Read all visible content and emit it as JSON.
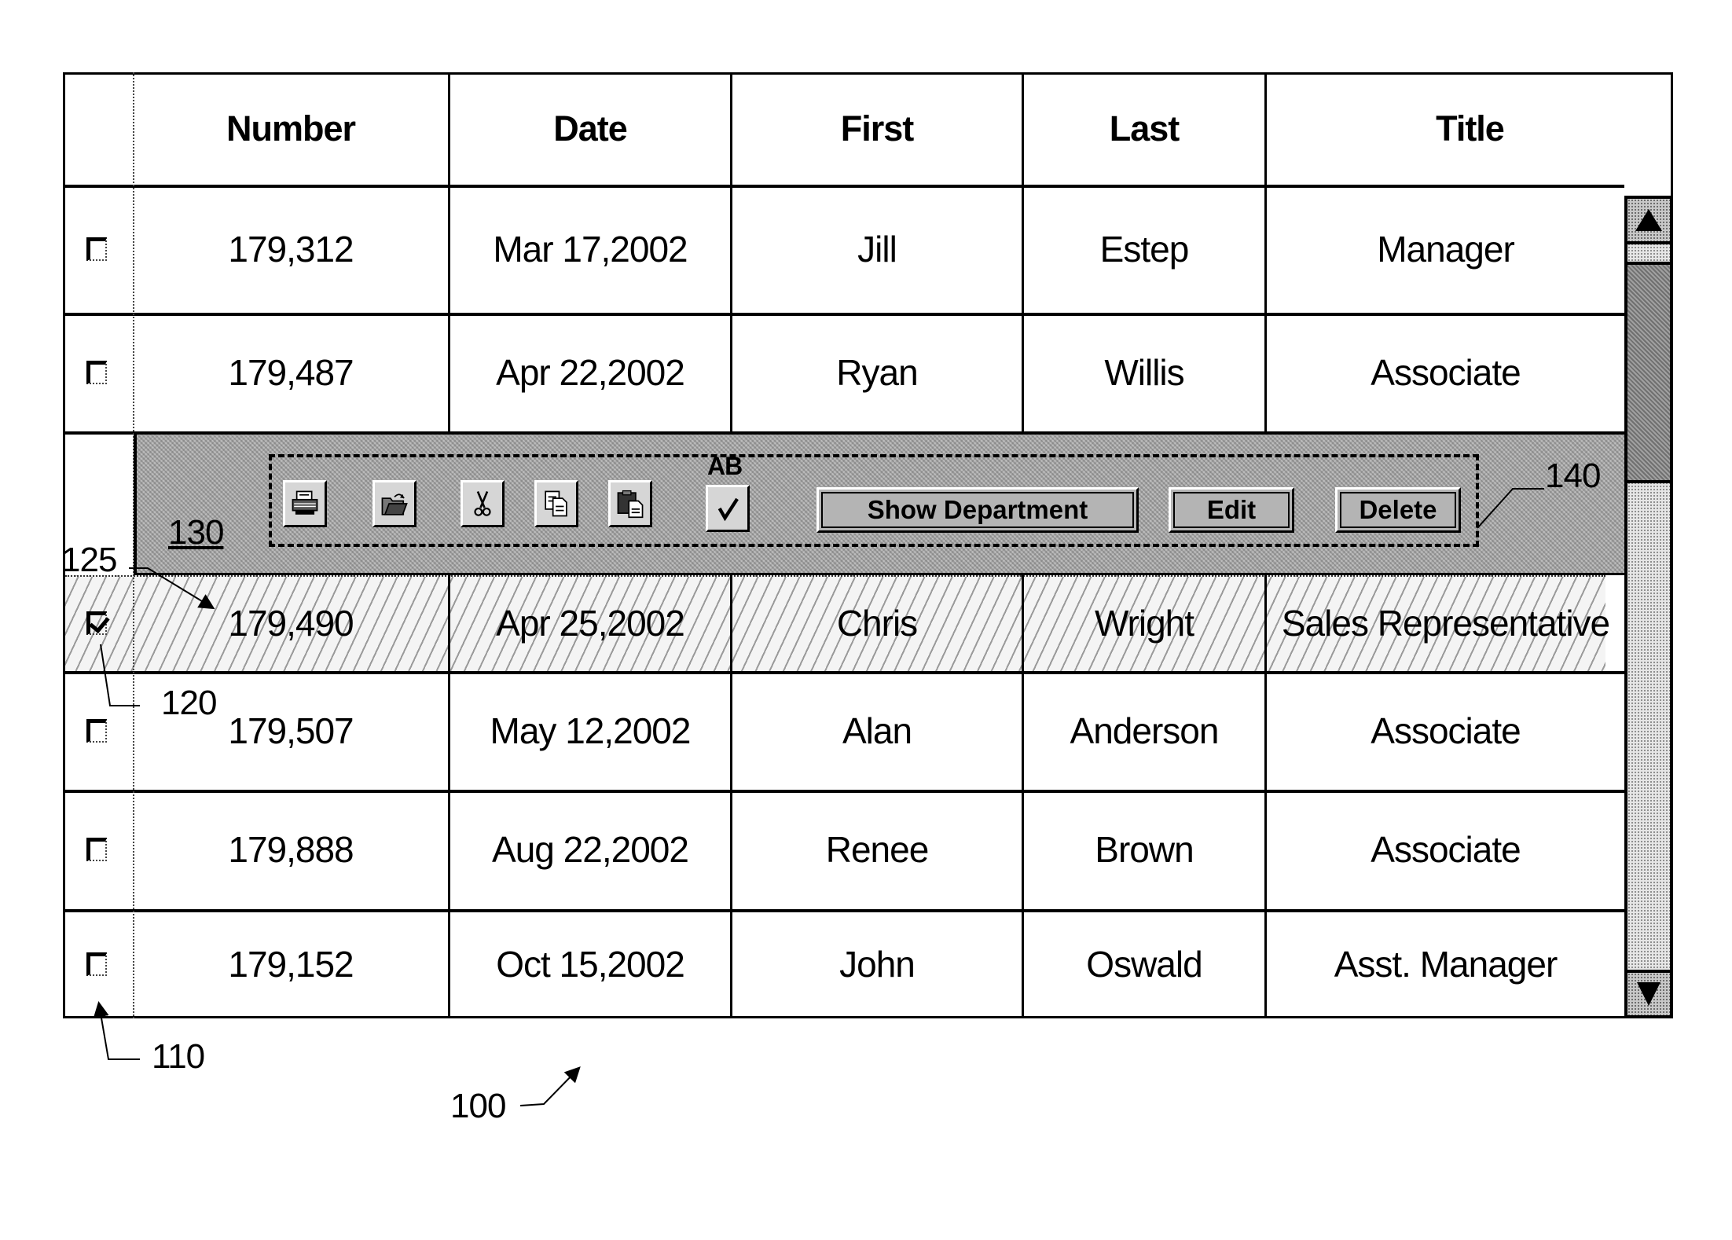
{
  "table": {
    "columns": [
      "Number",
      "Date",
      "First",
      "Last",
      "Title"
    ],
    "rows": [
      {
        "checked": false,
        "number": "179,312",
        "date": "Mar 17,2002",
        "first": "Jill",
        "last": "Estep",
        "title": "Manager"
      },
      {
        "checked": false,
        "number": "179,487",
        "date": "Apr 22,2002",
        "first": "Ryan",
        "last": "Willis",
        "title": "Associate"
      },
      {
        "checked": true,
        "number": "179,490",
        "date": "Apr 25,2002",
        "first": "Chris",
        "last": "Wright",
        "title": "Sales Representative"
      },
      {
        "checked": false,
        "number": "179,507",
        "date": "May 12,2002",
        "first": "Alan",
        "last": "Anderson",
        "title": "Associate"
      },
      {
        "checked": false,
        "number": "179,888",
        "date": "Aug 22,2002",
        "first": "Renee",
        "last": "Brown",
        "title": "Associate"
      },
      {
        "checked": false,
        "number": "179,152",
        "date": "Oct 15,2002",
        "first": "John",
        "last": "Oswald",
        "title": "Asst. Manager"
      }
    ],
    "selected_row_index": 2
  },
  "toolbar": {
    "icons": [
      {
        "name": "print-icon",
        "label": "Print"
      },
      {
        "name": "open-folder-icon",
        "label": "Open"
      },
      {
        "name": "cut-icon",
        "label": "Cut"
      },
      {
        "name": "copy-icon",
        "label": "Copy"
      },
      {
        "name": "paste-icon",
        "label": "Paste"
      },
      {
        "name": "spell-check-icon",
        "label": "Spell Check",
        "text": "AB"
      }
    ],
    "buttons": {
      "show_department": "Show Department",
      "edit": "Edit",
      "delete": "Delete"
    }
  },
  "scrollbar": {
    "up_icon": "arrow-up-icon",
    "down_icon": "arrow-down-icon"
  },
  "reference_labels": {
    "table": "100",
    "checkbox_column": "110",
    "checkbox": "120",
    "selected_row": "125",
    "toolbar": "130",
    "button_group": "140"
  },
  "colors": {
    "toolbar_bg": "#a9a9a9",
    "grid_line": "#000000",
    "background": "#ffffff"
  }
}
